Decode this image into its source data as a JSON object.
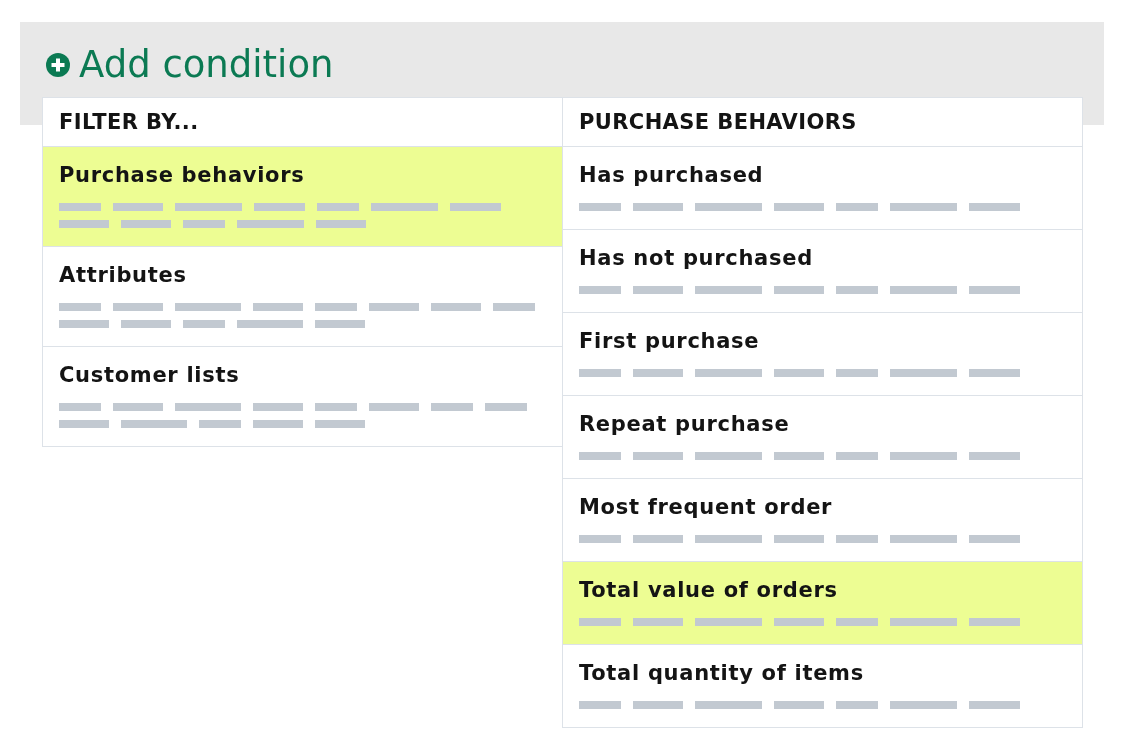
{
  "add_condition": {
    "label": "Add condition"
  },
  "filter_panel": {
    "heading": "FILTER BY...",
    "items": [
      {
        "label": "Purchase behaviors",
        "selected": true
      },
      {
        "label": "Attributes",
        "selected": false
      },
      {
        "label": "Customer lists",
        "selected": false
      }
    ]
  },
  "behavior_panel": {
    "heading": "PURCHASE BEHAVIORS",
    "items": [
      {
        "label": "Has purchased",
        "selected": false
      },
      {
        "label": "Has not purchased",
        "selected": false
      },
      {
        "label": "First purchase",
        "selected": false
      },
      {
        "label": "Repeat purchase",
        "selected": false
      },
      {
        "label": "Most frequent order",
        "selected": false
      },
      {
        "label": "Total value of orders",
        "selected": true
      },
      {
        "label": "Total quantity of items",
        "selected": false
      }
    ]
  }
}
